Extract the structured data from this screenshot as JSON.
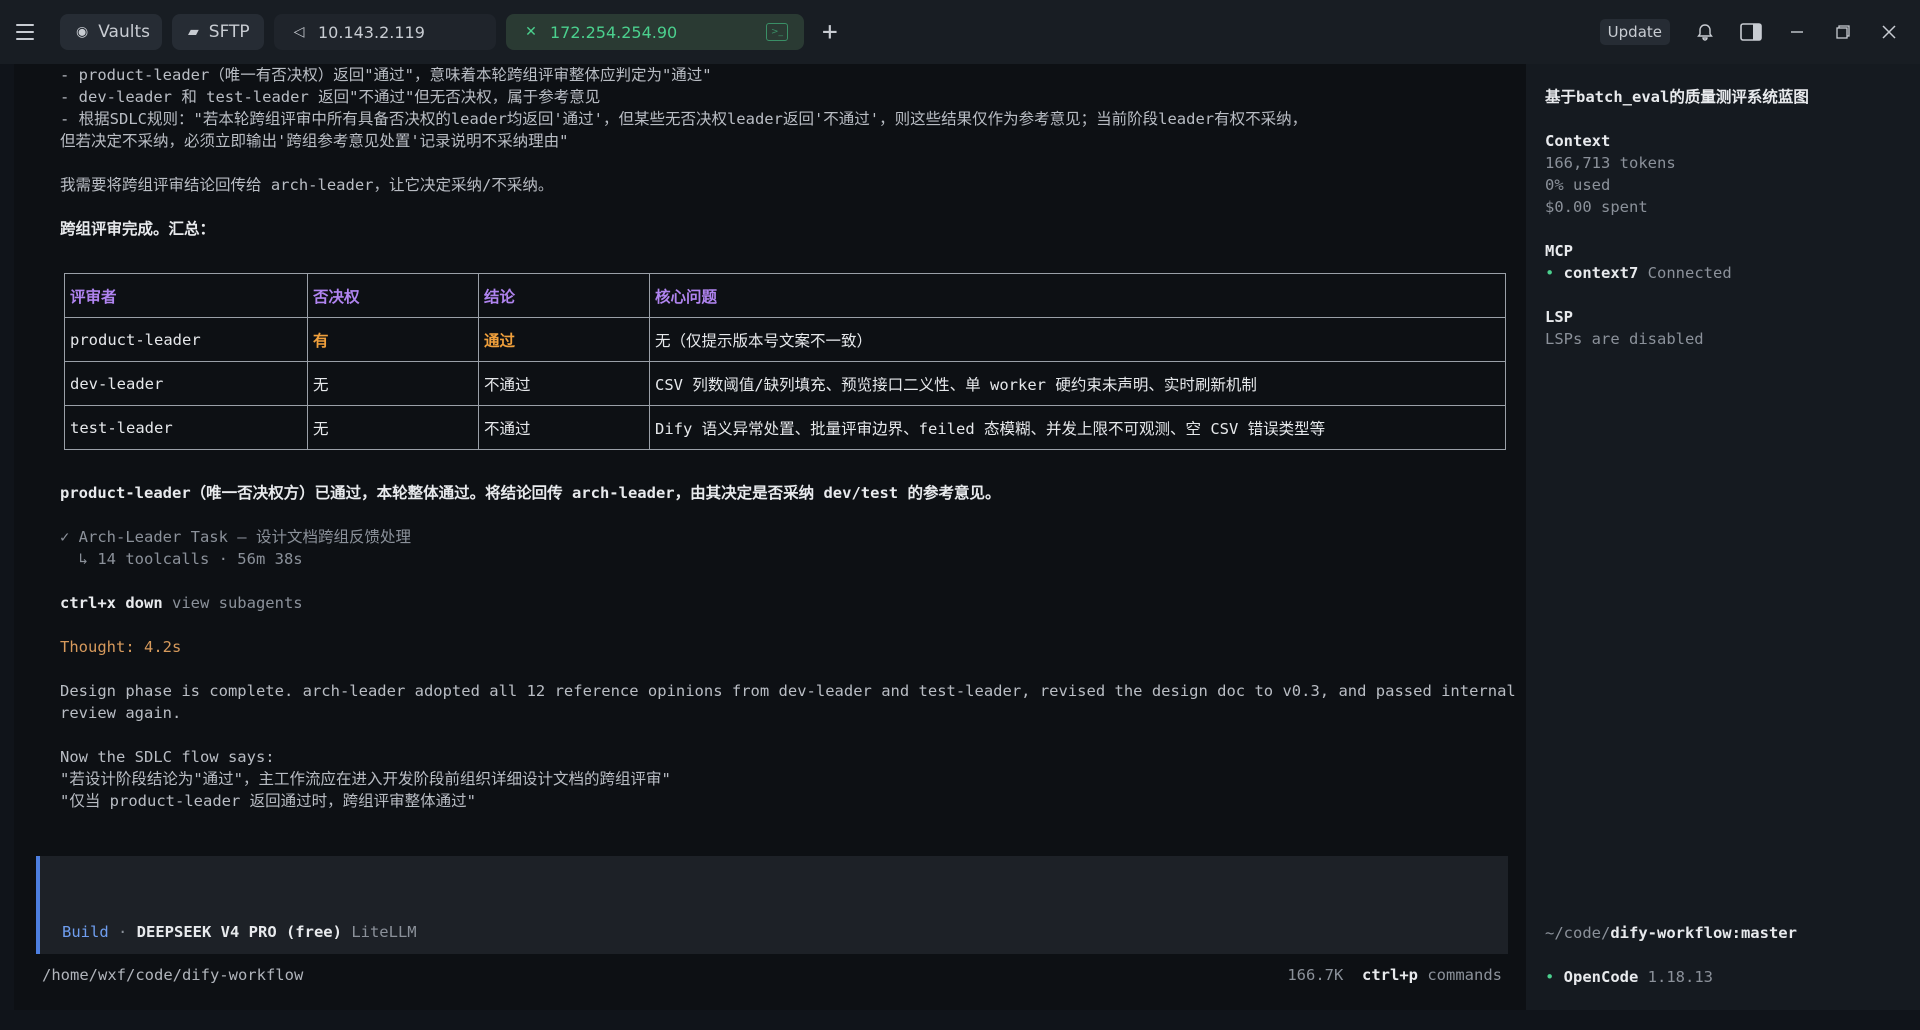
{
  "tabs": {
    "vaults": "Vaults",
    "sftp": "SFTP",
    "host1": "10.143.2.119",
    "host2": "172.254.254.90"
  },
  "controls": {
    "update": "Update"
  },
  "transcript": {
    "l1": "- product-leader（唯一有否决权）返回\"通过\"，意味着本轮跨组评审整体应判定为\"通过\"",
    "l2": "- dev-leader 和 test-leader 返回\"不通过\"但无否决权，属于参考意见",
    "l3": "- 根据SDLC规则：\"若本轮跨组评审中所有具备否决权的leader均返回'通过'，但某些无否决权leader返回'不通过'，则这些结果仅作为参考意见；当前阶段leader有权不采纳，",
    "l4": "但若决定不采纳，必须立即输出'跨组参考意见处置'记录说明不采纳理由\"",
    "l5": "我需要将跨组评审结论回传给 arch-leader，让它决定采纳/不采纳。",
    "l6": "跨组评审完成。汇总：",
    "table": {
      "headers": [
        "评审者",
        "否决权",
        "结论",
        "核心问题"
      ],
      "rows": [
        [
          "product-leader",
          "有",
          "通过",
          "无（仅提示版本号文案不一致）"
        ],
        [
          "dev-leader",
          "无",
          "不通过",
          "CSV 列数阈值/缺列填充、预览接口二义性、单 worker 硬约束未声明、实时刷新机制"
        ],
        [
          "test-leader",
          "无",
          "不通过",
          "Dify 语义异常处置、批量评审边界、feiled 态模糊、并发上限不可观测、空 CSV 错误类型等"
        ]
      ]
    },
    "l7": "product-leader（唯一否决权方）已通过，本轮整体通过。将结论回传 arch-leader，由其决定是否采纳 dev/test 的参考意见。",
    "task": "✓ Arch-Leader Task — 设计文档跨组反馈处理",
    "task_sub": "  ↳ 14 toolcalls · 56m 38s",
    "shortcut_key": "ctrl+x down",
    "shortcut_label": " view subagents",
    "thought": "Thought: 4.2s",
    "p1": "Design phase is complete. arch-leader adopted all 12 reference opinions from dev-leader and test-leader, revised the design doc to v0.3, and passed internal",
    "p2": "review again.",
    "p3": "Now the SDLC flow says:",
    "p4": "\"若设计阶段结论为\"通过\"，主工作流应在进入开发阶段前组织详细设计文档的跨组评审\"",
    "p5": "\"仅当 product-leader 返回通过时，跨组评审整体通过\""
  },
  "input": {
    "mode": "Build",
    "sep": " · ",
    "model": "DEEPSEEK V4 PRO (free)",
    "provider": " LiteLLM"
  },
  "footer": {
    "path": "/home/wxf/code/dify-workflow",
    "tokens": "166.7K",
    "cmd_key": "ctrl+p",
    "cmd_label": " commands"
  },
  "sidebar": {
    "title": "基于batch_eval的质量测评系统蓝图",
    "context_title": "Context",
    "tokens": "166,713 tokens",
    "used": "0% used",
    "spent": "$0.00 spent",
    "mcp_title": "MCP",
    "mcp_name": "context7",
    "mcp_status": " Connected",
    "lsp_title": "LSP",
    "lsp_status": "LSPs are disabled",
    "path_prefix": "~/code/",
    "path_repo": "dify-workflow:master",
    "app_name": "OpenCode",
    "app_version": " 1.18.13"
  }
}
